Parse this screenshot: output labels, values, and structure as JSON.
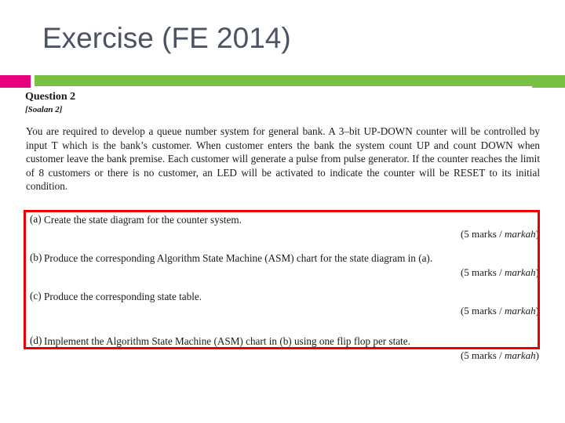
{
  "slide": {
    "title": "Exercise (FE 2014)",
    "accent_pink": "#e6007e",
    "accent_green": "#79c143",
    "title_color": "#4c5365",
    "highlight_box_color": "#ee0000"
  },
  "document": {
    "question_heading": "Question 2",
    "question_subheading": "[Soalan 2]",
    "body": "You are required to develop a queue number system for general bank. A 3–bit UP-DOWN counter will be controlled by input T which is the bank’s customer. When customer enters the bank the system count UP and count DOWN when customer leave the bank premise. Each customer will generate a pulse from pulse generator. If the counter reaches the limit of 8 customers or there is no customer, an LED will be activated to indicate the counter will be RESET to its initial condition.",
    "items": [
      {
        "label": "(a)",
        "text": "Create the state diagram for the counter system.",
        "marks_prefix": "(5 marks / ",
        "marks_italic": "markah",
        "marks_suffix": ")"
      },
      {
        "label": "(b)",
        "text": "Produce the corresponding Algorithm State Machine (ASM) chart for the state diagram in (a).",
        "marks_prefix": "(5 marks / ",
        "marks_italic": "markah",
        "marks_suffix": ")"
      },
      {
        "label": "(c)",
        "text": "Produce the corresponding state table.",
        "marks_prefix": "(5 marks / ",
        "marks_italic": "markah",
        "marks_suffix": ")"
      },
      {
        "label": "(d)",
        "text": "Implement the Algorithm State Machine (ASM) chart in (b) using one flip flop per state.",
        "marks_prefix": "(5 marks / ",
        "marks_italic": "markah",
        "marks_suffix": ")"
      }
    ]
  }
}
